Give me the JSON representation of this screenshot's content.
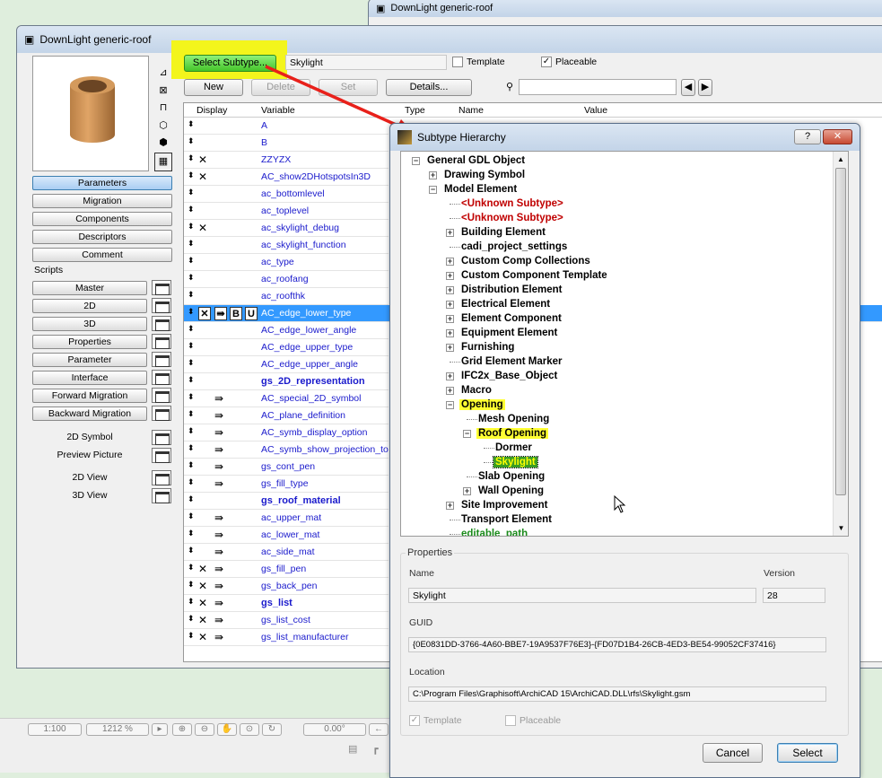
{
  "back_window": {
    "title": "DownLight generic-roof"
  },
  "main_window": {
    "title": "DownLight generic-roof",
    "select_subtype_label": "Select Subtype...",
    "subtype_value": "Skylight",
    "template_label": "Template",
    "template_checked": false,
    "placeable_label": "Placeable",
    "placeable_checked": true,
    "toolbar": {
      "new": "New",
      "delete": "Delete",
      "set": "Set",
      "details": "Details...",
      "search_value": ""
    },
    "columns": [
      "Display",
      "Variable",
      "Type",
      "Name",
      "Value"
    ],
    "side_buttons": [
      "Parameters",
      "Migration",
      "Components",
      "Descriptors",
      "Comment"
    ],
    "scripts_label": "Scripts",
    "script_buttons": [
      "Master",
      "2D",
      "3D",
      "Properties",
      "Parameter",
      "Interface",
      "Forward Migration",
      "Backward Migration"
    ],
    "view_items": [
      "2D Symbol",
      "Preview Picture",
      "2D View",
      "3D View"
    ],
    "rows": [
      {
        "var": "A",
        "d": ""
      },
      {
        "var": "B",
        "d": ""
      },
      {
        "var": "ZZYZX",
        "d": "x"
      },
      {
        "var": "AC_show2DHotspotsIn3D",
        "d": "x"
      },
      {
        "var": "ac_bottomlevel",
        "d": ""
      },
      {
        "var": "ac_toplevel",
        "d": ""
      },
      {
        "var": "ac_skylight_debug",
        "d": "x"
      },
      {
        "var": "ac_skylight_function",
        "d": ""
      },
      {
        "var": "ac_type",
        "d": ""
      },
      {
        "var": "ac_roofang",
        "d": ""
      },
      {
        "var": "ac_roofthk",
        "d": ""
      },
      {
        "var": "AC_edge_lower_type",
        "d": "xabu",
        "selected": true
      },
      {
        "var": "AC_edge_lower_angle",
        "d": ""
      },
      {
        "var": "AC_edge_upper_type",
        "d": ""
      },
      {
        "var": "AC_edge_upper_angle",
        "d": ""
      },
      {
        "var": "gs_2D_representation",
        "d": "",
        "bold": true
      },
      {
        "var": "AC_special_2D_symbol",
        "d": "a"
      },
      {
        "var": "AC_plane_definition",
        "d": "a"
      },
      {
        "var": "AC_symb_display_option",
        "d": "a"
      },
      {
        "var": "AC_symb_show_projection_to",
        "d": "a"
      },
      {
        "var": "gs_cont_pen",
        "d": "a"
      },
      {
        "var": "gs_fill_type",
        "d": "a"
      },
      {
        "var": "gs_roof_material",
        "d": "",
        "bold": true
      },
      {
        "var": "ac_upper_mat",
        "d": "a"
      },
      {
        "var": "ac_lower_mat",
        "d": "a"
      },
      {
        "var": "ac_side_mat",
        "d": "a"
      },
      {
        "var": "gs_fill_pen",
        "d": "xa"
      },
      {
        "var": "gs_back_pen",
        "d": "xa"
      },
      {
        "var": "gs_list",
        "d": "xa",
        "bold": true
      },
      {
        "var": "gs_list_cost",
        "d": "xa"
      },
      {
        "var": "gs_list_manufacturer",
        "d": "xa"
      }
    ]
  },
  "status_bar": {
    "scale": "1:100",
    "zoom": "1212 %",
    "angle": "0.00°"
  },
  "dialog": {
    "title": "Subtype Hierarchy",
    "tree": [
      {
        "label": "General GDL Object",
        "level": 0,
        "exp": "-"
      },
      {
        "label": "Drawing Symbol",
        "level": 1,
        "exp": "+"
      },
      {
        "label": "Model Element",
        "level": 1,
        "exp": "-"
      },
      {
        "label": "<Unknown Subtype>",
        "level": 2,
        "exp": "",
        "color": "#c00000"
      },
      {
        "label": "<Unknown Subtype>",
        "level": 2,
        "exp": "",
        "color": "#c00000"
      },
      {
        "label": "Building Element",
        "level": 2,
        "exp": "+"
      },
      {
        "label": "cadi_project_settings",
        "level": 2,
        "exp": ""
      },
      {
        "label": "Custom Comp Collections",
        "level": 2,
        "exp": "+"
      },
      {
        "label": "Custom Component Template",
        "level": 2,
        "exp": "+"
      },
      {
        "label": "Distribution Element",
        "level": 2,
        "exp": "+"
      },
      {
        "label": "Electrical Element",
        "level": 2,
        "exp": "+"
      },
      {
        "label": "Element Component",
        "level": 2,
        "exp": "+"
      },
      {
        "label": "Equipment Element",
        "level": 2,
        "exp": "+"
      },
      {
        "label": "Furnishing",
        "level": 2,
        "exp": "+"
      },
      {
        "label": "Grid Element Marker",
        "level": 2,
        "exp": ""
      },
      {
        "label": "IFC2x_Base_Object",
        "level": 2,
        "exp": "+"
      },
      {
        "label": "Macro",
        "level": 2,
        "exp": "+"
      },
      {
        "label": "Opening",
        "level": 2,
        "exp": "-",
        "highlight": true
      },
      {
        "label": "Mesh Opening",
        "level": 3,
        "exp": ""
      },
      {
        "label": "Roof Opening",
        "level": 3,
        "exp": "-",
        "highlight": true
      },
      {
        "label": "Dormer",
        "level": 4,
        "exp": ""
      },
      {
        "label": "Skylight",
        "level": 4,
        "exp": "",
        "selected": true
      },
      {
        "label": "Slab Opening",
        "level": 3,
        "exp": ""
      },
      {
        "label": "Wall Opening",
        "level": 3,
        "exp": "+"
      },
      {
        "label": "Site Improvement",
        "level": 2,
        "exp": "+"
      },
      {
        "label": "Transport Element",
        "level": 2,
        "exp": ""
      },
      {
        "label": "editable_path",
        "level": 2,
        "exp": "",
        "color": "#1a8a1a"
      }
    ],
    "properties": {
      "group_label": "Properties",
      "name_label": "Name",
      "name": "Skylight",
      "version_label": "Version",
      "version": "28",
      "guid_label": "GUID",
      "guid": "{0E0831DD-3766-4A60-BBE7-19A9537F76E3}-{FD07D1B4-26CB-4ED3-BE54-99052CF37416}",
      "location_label": "Location",
      "location": "C:\\Program Files\\Graphisoft\\ArchiCAD 15\\ArchiCAD.DLL\\rfs\\Skylight.gsm",
      "template_label": "Template",
      "template_checked": true,
      "placeable_label": "Placeable",
      "placeable_checked": false
    },
    "cancel": "Cancel",
    "select": "Select",
    "help": "?",
    "close": "✕"
  },
  "colors": {
    "highlight": "#ffff33",
    "selection": "#3399ff",
    "variable_text": "#1a1acc",
    "annotation_arrow": "#e8201a"
  }
}
